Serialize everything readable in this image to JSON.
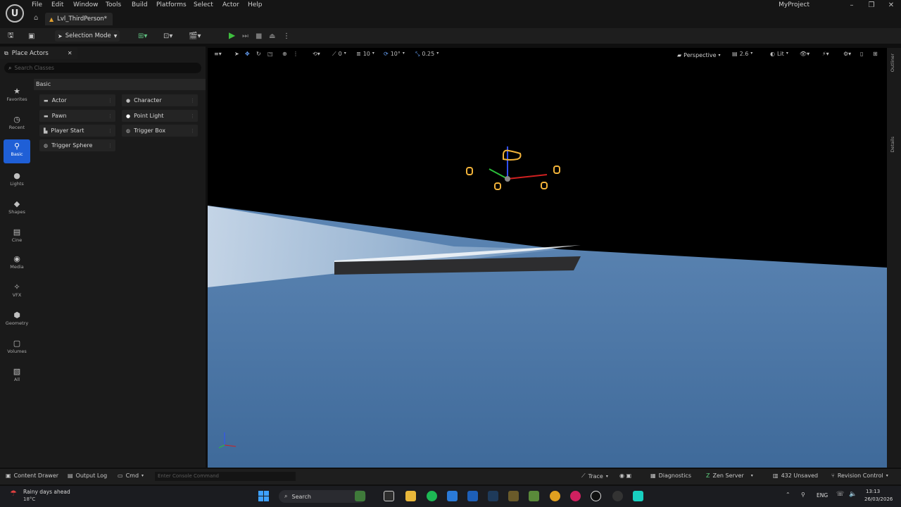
{
  "app": {
    "project_name": "MyProject",
    "logo_text": "U",
    "level_tab": "Lvl_ThirdPerson*"
  },
  "menu": [
    "File",
    "Edit",
    "Window",
    "Tools",
    "Build",
    "Platforms",
    "Select",
    "Actor",
    "Help"
  ],
  "window_controls": {
    "minimize": "–",
    "maximize": "❐",
    "close": "✕"
  },
  "toolbar": {
    "selection_mode": "Selection Mode"
  },
  "place_actors": {
    "tab_label": "Place Actors",
    "search_placeholder": "Search Classes",
    "categories": [
      "Favorites",
      "Recent",
      "Basic",
      "Lights",
      "Shapes",
      "Cine",
      "Media",
      "VFX",
      "Geometry",
      "Volumes",
      "All"
    ],
    "active_category": "Basic",
    "section_header": "Basic",
    "items": [
      "Actor",
      "Character",
      "Pawn",
      "Point Light",
      "Player Start",
      "Trigger Box",
      "Trigger Sphere"
    ]
  },
  "viewport": {
    "grid_snap": "10",
    "rotation_snap": "10°",
    "scale_snap": "0.25",
    "angle_value": "0",
    "view_mode": "Perspective",
    "camera_speed": "2.6",
    "lighting": "Lit"
  },
  "right_strip": {
    "outliner": "Outliner",
    "details": "Details"
  },
  "status_bar": {
    "content_drawer": "Content Drawer",
    "output_log": "Output Log",
    "cmd": "Cmd",
    "console_placeholder": "Enter Console Command",
    "trace": "Trace",
    "diagnostics": "Diagnostics",
    "zen_server": "Zen Server",
    "unsaved": "432 Unsaved",
    "revision_control": "Revision Control"
  },
  "taskbar": {
    "weather_text": "Rainy days ahead",
    "temperature": "18°C",
    "search_label": "Search",
    "language": "ENG",
    "time": "13:13",
    "date": "26/03/2026"
  },
  "colors": {
    "accent_blue": "#1f5fd6",
    "play_green": "#3fbf3f",
    "sky_blue": "#4f76a3",
    "gizmo_orange": "#f2b33a"
  }
}
